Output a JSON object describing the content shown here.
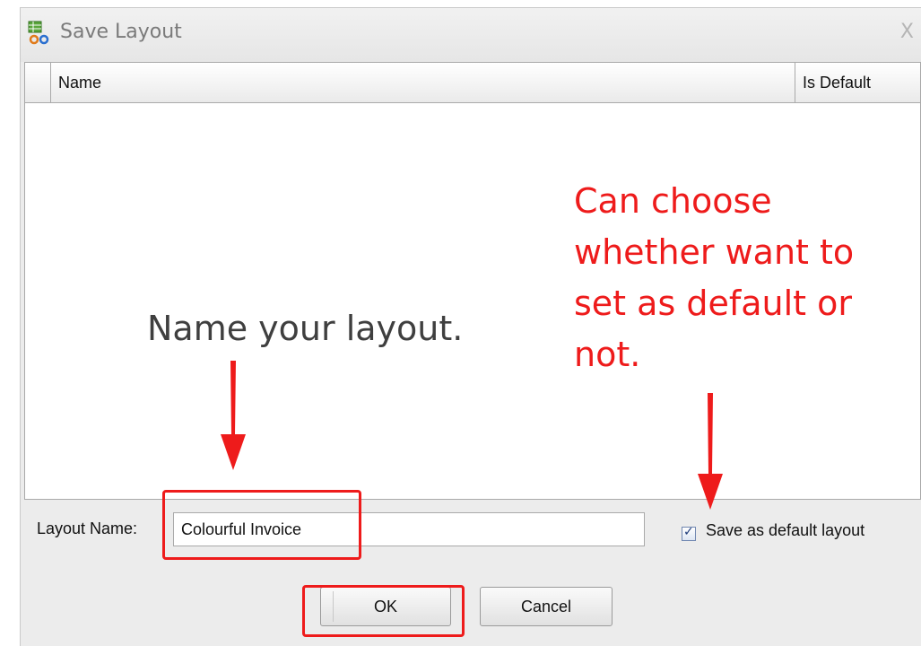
{
  "window": {
    "title": "Save Layout",
    "close_glyph": "X"
  },
  "grid": {
    "columns": [
      {
        "label": "Name"
      },
      {
        "label": "Is Default"
      }
    ],
    "rows": []
  },
  "form": {
    "layout_name_label": "Layout Name:",
    "layout_name_value": "Colourful Invoice",
    "save_default_label": "Save as default layout",
    "save_default_checked": true
  },
  "buttons": {
    "ok": "OK",
    "cancel": "Cancel"
  },
  "annotations": {
    "name_hint": "Name your layout.",
    "default_hint": "Can choose whether want to set as default or not."
  },
  "colors": {
    "annotation_red": "#ee1b1b",
    "annotation_text": "#3f3f3f"
  },
  "icons": {
    "app": "layout-grid-icon",
    "close": "close-icon",
    "check": "checkmark-icon"
  }
}
